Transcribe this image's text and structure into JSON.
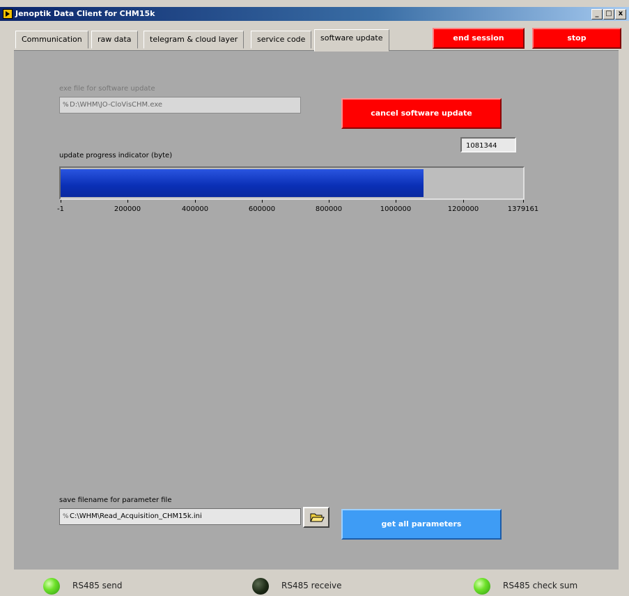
{
  "window": {
    "title": "Jenoptik Data Client for CHM15k",
    "controls": [
      "_",
      "□",
      "x"
    ]
  },
  "tabs": [
    {
      "label": "Communication",
      "active": false
    },
    {
      "label": "raw data",
      "active": false
    },
    {
      "label": "telegram & cloud layer",
      "active": false
    },
    {
      "label": "service code",
      "active": false
    },
    {
      "label": "software update",
      "active": true
    }
  ],
  "toolbar": {
    "end_session_label": "end session",
    "stop_label": "stop"
  },
  "update": {
    "exe_label": "exe file for software update",
    "exe_path": "D:\\WHM\\JO-CloVisCHM.exe",
    "cancel_label": "cancel software update",
    "progress_label": "update progress indicator (byte)",
    "progress_value": "1081344",
    "progress_current": 1081344,
    "progress_min": -1,
    "progress_max": 1379161,
    "scale_ticks": [
      {
        "value": -1,
        "label": "-1"
      },
      {
        "value": 200000,
        "label": "200000"
      },
      {
        "value": 400000,
        "label": "400000"
      },
      {
        "value": 600000,
        "label": "600000"
      },
      {
        "value": 800000,
        "label": "800000"
      },
      {
        "value": 1000000,
        "label": "1000000"
      },
      {
        "value": 1200000,
        "label": "1200000"
      },
      {
        "value": 1379161,
        "label": "1379161"
      }
    ]
  },
  "parameters": {
    "save_label": "save filename for parameter file",
    "save_path": "C:\\WHM\\Read_Acquisition_CHM15k.ini",
    "get_all_label": "get all parameters"
  },
  "status": [
    {
      "label": "RS485 send",
      "state": "on"
    },
    {
      "label": "RS485 receive",
      "state": "off"
    },
    {
      "label": "RS485 check sum",
      "state": "on"
    }
  ],
  "colors": {
    "panel": "#a9a9a9",
    "stop_red": "#ff0000",
    "progress_blue": "#0a2fb5",
    "get_all_blue": "#3e9cf5",
    "led_green": "#6ee22a"
  }
}
